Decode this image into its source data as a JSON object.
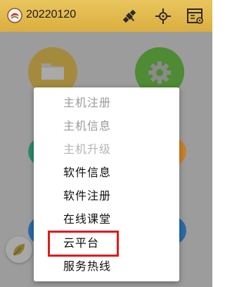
{
  "header": {
    "title": "20220120",
    "icons": [
      "app-logo",
      "satellite-icon",
      "crosshair-icon",
      "settings-window-icon"
    ]
  },
  "background": {
    "tiles": [
      "folder-tile",
      "gear-tile"
    ]
  },
  "menu": {
    "items": [
      {
        "label": "主机注册",
        "enabled": false
      },
      {
        "label": "主机信息",
        "enabled": false
      },
      {
        "label": "主机升级",
        "enabled": false
      },
      {
        "label": "软件信息",
        "enabled": true
      },
      {
        "label": "软件注册",
        "enabled": true
      },
      {
        "label": "在线课堂",
        "enabled": true
      },
      {
        "label": "云平台",
        "enabled": true,
        "highlighted": true
      },
      {
        "label": "服务热线",
        "enabled": true
      }
    ]
  },
  "colors": {
    "header": "#dbae3e",
    "overlay": "#9c9c9c",
    "highlight": "#e01a1a"
  }
}
